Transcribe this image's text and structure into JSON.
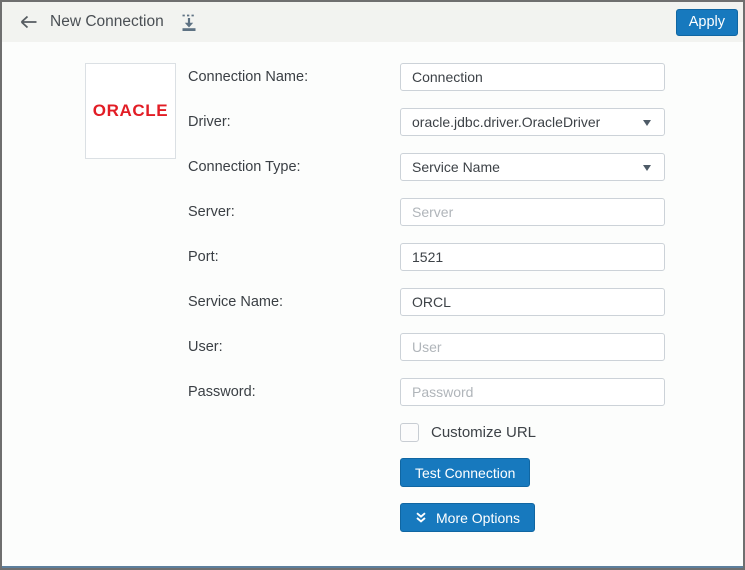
{
  "colors": {
    "accent_blue": "#1779be",
    "oracle_red": "#e21d25",
    "header_bg": "#f2f3f0"
  },
  "header": {
    "title": "New Connection",
    "apply_label": "Apply"
  },
  "logo": {
    "text": "ORACLE"
  },
  "form": {
    "rows": [
      {
        "label": "Connection Name:",
        "type": "text",
        "value": "Connection"
      },
      {
        "label": "Driver:",
        "type": "select",
        "value": "oracle.jdbc.driver.OracleDriver"
      },
      {
        "label": "Connection Type:",
        "type": "select",
        "value": "Service Name"
      },
      {
        "label": "Server:",
        "type": "text",
        "placeholder": "Server"
      },
      {
        "label": "Port:",
        "type": "text",
        "value": "1521"
      },
      {
        "label": "Service Name:",
        "type": "text",
        "value": "ORCL"
      },
      {
        "label": "User:",
        "type": "text",
        "placeholder": "User"
      },
      {
        "label": "Password:",
        "type": "password",
        "placeholder": "Password"
      }
    ]
  },
  "options": {
    "customize_url_label": "Customize URL",
    "customize_url_checked": false
  },
  "buttons": {
    "test_connection": "Test Connection",
    "more_options": "More Options"
  }
}
